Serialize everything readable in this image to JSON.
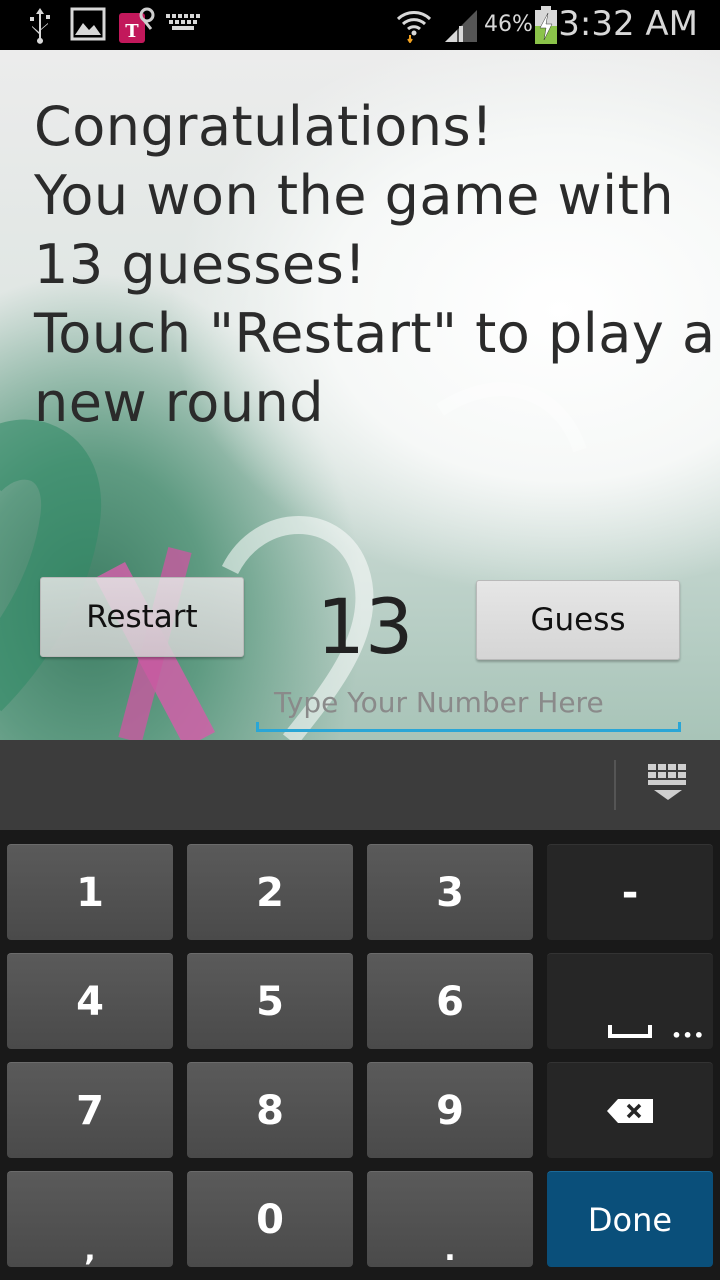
{
  "status_bar": {
    "icons": [
      "usb-icon",
      "gallery-icon",
      "tmobile-icon",
      "keyboard-icon",
      "wifi-icon",
      "signal-icon",
      "battery-charging-icon"
    ],
    "battery_percent": "46%",
    "time": "3:32 AM"
  },
  "game": {
    "message_lines": [
      "Congratulations!",
      "You won the game with",
      "13 guesses!",
      "Touch \"Restart\" to play a",
      "new round"
    ],
    "restart_label": "Restart",
    "guess_label": "Guess",
    "current_number": "13",
    "input_placeholder": "Type Your Number Here",
    "input_value": ""
  },
  "keyboard": {
    "keys": [
      "1",
      "2",
      "3",
      "-",
      "4",
      "5",
      "6",
      "space",
      "7",
      "8",
      "9",
      "backspace",
      ",",
      "0",
      ".",
      "Done"
    ],
    "done_label": "Done",
    "accent_color": "#0a4f7a",
    "input_underline_color": "#2aa6d6"
  }
}
